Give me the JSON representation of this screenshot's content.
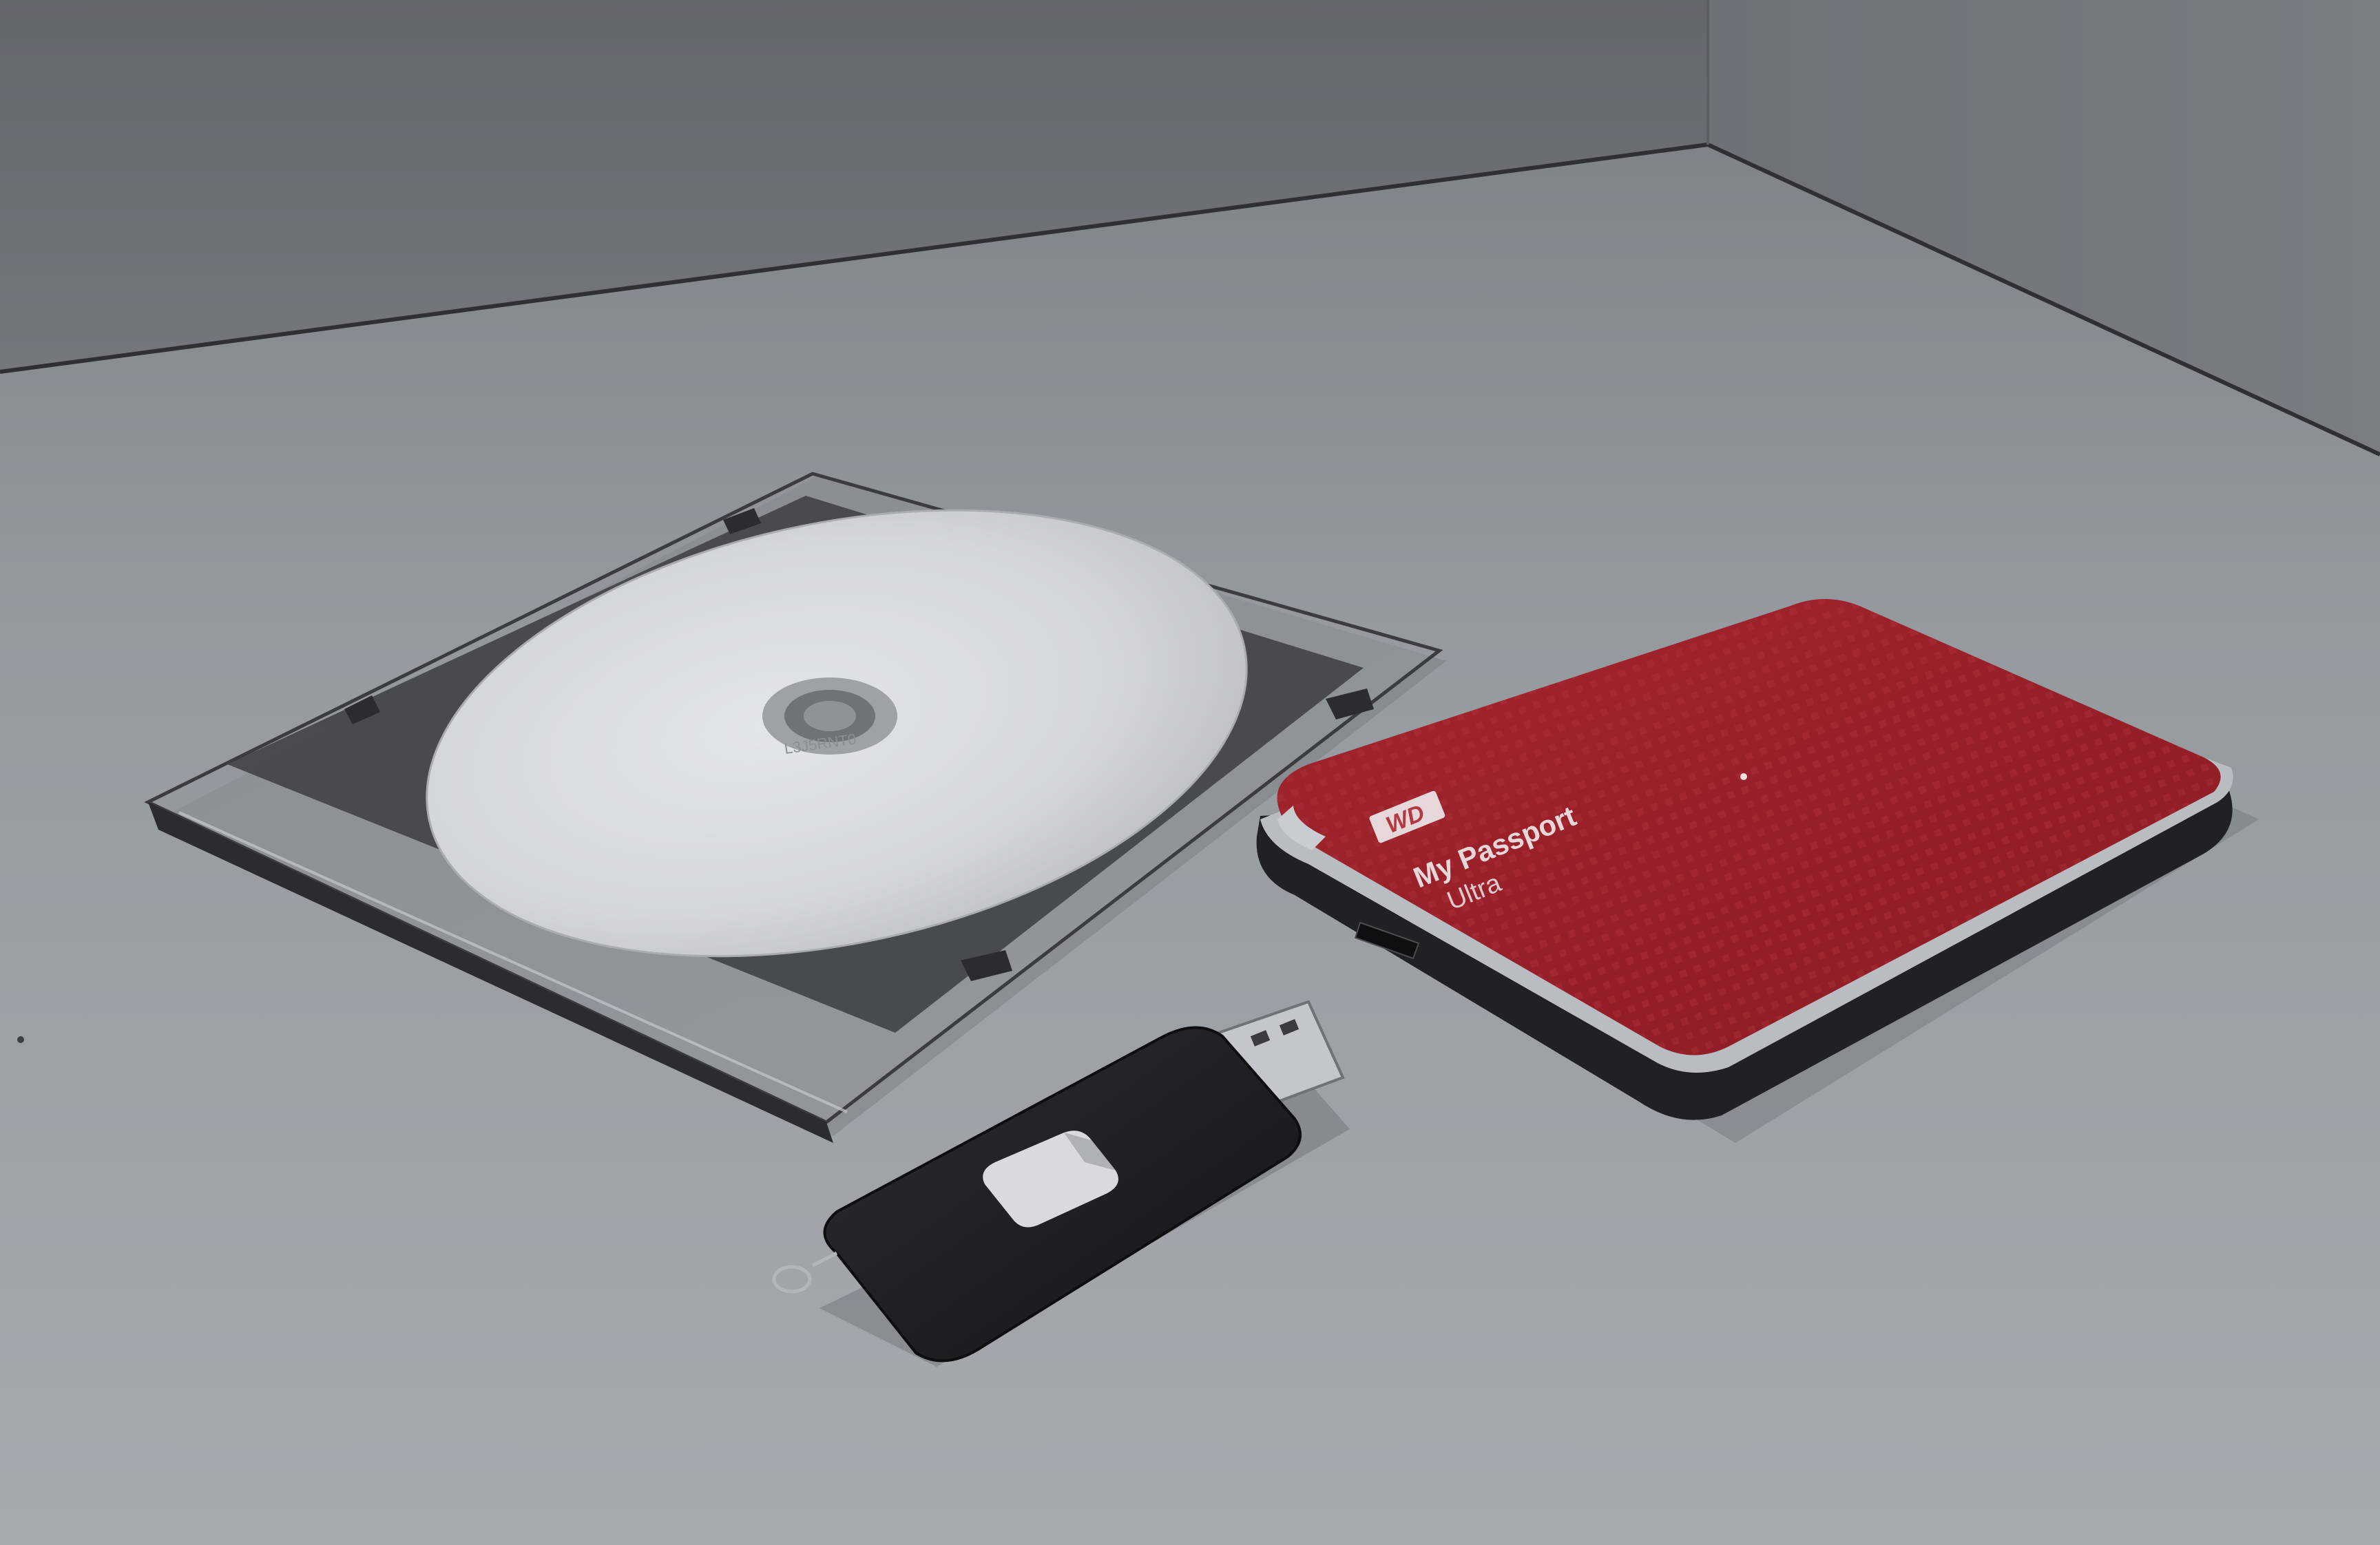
{
  "scene": {
    "colors": {
      "wall": "#6d7075",
      "wall_corner": "#75797e",
      "floor_near": "#a2a6ab",
      "floor_far": "#858a8f",
      "drive_red": "#9c1e26",
      "drive_red_light": "#b8323a",
      "drive_trim": "#b9bcc0",
      "drive_base": "#1f2124",
      "usb_black": "#1c1e21",
      "usb_slider": "#d8dadd",
      "usb_connector": "#c3c6ca",
      "disc_white": "#dcdfe2",
      "case_tray": "#3a3c40"
    },
    "objects": {
      "cd_case": {
        "name": "clear slim CD case with white disc",
        "disc_print": "L3J5RNT0"
      },
      "external_drive": {
        "name": "red external hard drive",
        "logo": "WD",
        "brand": "My Passport",
        "model": "Ultra"
      },
      "usb_drive": {
        "name": "black retractable USB flash drive"
      }
    }
  }
}
